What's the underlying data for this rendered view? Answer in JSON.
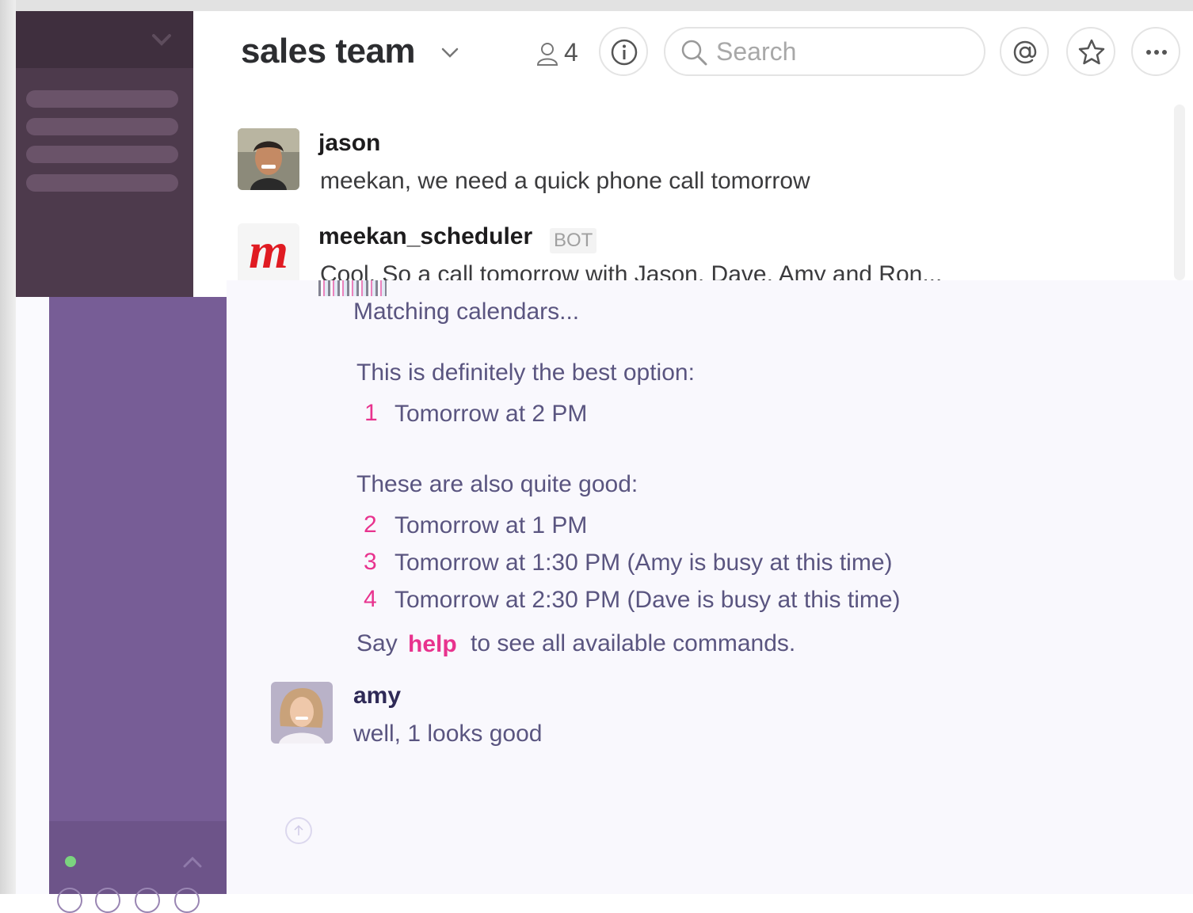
{
  "header": {
    "channel_name": "sales team",
    "member_count": "4",
    "search_placeholder": "Search"
  },
  "messages": [
    {
      "author": "jason",
      "text": "meekan, we need a quick phone call tomorrow"
    },
    {
      "author": "meekan_scheduler",
      "badge": "BOT",
      "text": "Cool. So a call tomorrow with Jason, Dave, Amy and Ron..."
    }
  ],
  "bot_reply": {
    "status": "Matching calendars...",
    "best_heading": "This is definitely the best option:",
    "best_options": [
      {
        "num": "1",
        "label": "Tomorrow at 2 PM"
      }
    ],
    "good_heading": "These are also quite good:",
    "good_options": [
      {
        "num": "2",
        "label": "Tomorrow at 1 PM"
      },
      {
        "num": "3",
        "label": "Tomorrow at 1:30 PM (Amy is busy at this time)"
      },
      {
        "num": "4",
        "label": "Tomorrow at 2:30 PM (Dave is busy at this time)"
      }
    ],
    "help_prefix": "Say",
    "help_word": "help",
    "help_suffix": "to see all available commands."
  },
  "reply": {
    "author": "amy",
    "text": "well, 1 looks good"
  },
  "colors": {
    "top_sidebar": "#4d3a4c",
    "bottom_sidebar": "#775d96",
    "accent_pink": "#e8338e",
    "bot_logo_red": "#e01b22"
  },
  "icons": [
    "chevron-down-icon",
    "member-icon",
    "info-icon",
    "search-icon",
    "at-icon",
    "star-icon",
    "more-icon",
    "chevron-up-icon",
    "arrow-up-icon"
  ]
}
